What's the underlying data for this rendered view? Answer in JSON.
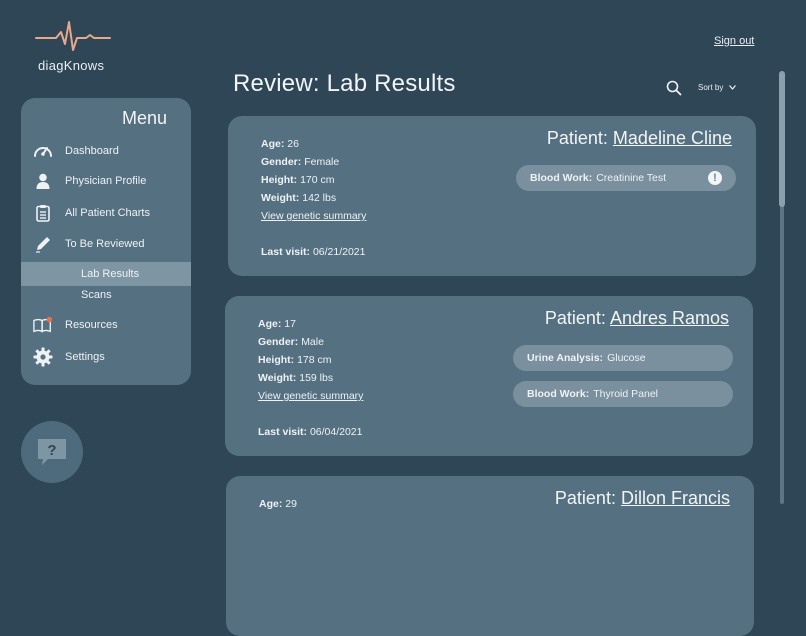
{
  "app": {
    "name": "diagKnows"
  },
  "header": {
    "title": "Review: Lab Results",
    "sign_out": "Sign out",
    "sort_label": "Sort by"
  },
  "sidebar": {
    "title": "Menu",
    "items": [
      {
        "label": "Dashboard",
        "icon": "speedometer-icon"
      },
      {
        "label": "Physician Profile",
        "icon": "user-icon"
      },
      {
        "label": "All Patient Charts",
        "icon": "clipboard-icon"
      },
      {
        "label": "To Be Reviewed",
        "icon": "pencil-icon"
      },
      {
        "label": "Lab Results",
        "sub": true,
        "active": true
      },
      {
        "label": "Scans",
        "sub": true
      },
      {
        "label": "Resources",
        "icon": "book-icon",
        "badge_color": "#e8734a"
      },
      {
        "label": "Settings",
        "icon": "gear-icon"
      }
    ]
  },
  "help": {
    "label": "?"
  },
  "labels": {
    "age": "Age:",
    "gender": "Gender:",
    "height": "Height:",
    "weight": "Weight:",
    "genetic_link": "View genetic summary",
    "last_visit": "Last visit:",
    "patient_prefix": "Patient:"
  },
  "patients": [
    {
      "name": "Madeline Cline",
      "age": "26",
      "gender": "Female",
      "height": "170 cm",
      "weight": "142 lbs",
      "last_visit": "06/21/2021",
      "tests": [
        {
          "type": "Blood Work:",
          "value": "Creatinine Test",
          "alert": "!"
        }
      ]
    },
    {
      "name": "Andres Ramos",
      "age": "17",
      "gender": "Male",
      "height": "178 cm",
      "weight": "159 lbs",
      "last_visit": "06/04/2021",
      "tests": [
        {
          "type": "Urine Analysis:",
          "value": "Glucose"
        },
        {
          "type": "Blood Work:",
          "value": " Thyroid Panel"
        }
      ]
    },
    {
      "name": "Dillon Francis",
      "age": "29"
    }
  ],
  "colors": {
    "background": "#2f4657",
    "panel": "#557080",
    "pill": "#7a909e",
    "logo_accent": "#e8a98b"
  }
}
